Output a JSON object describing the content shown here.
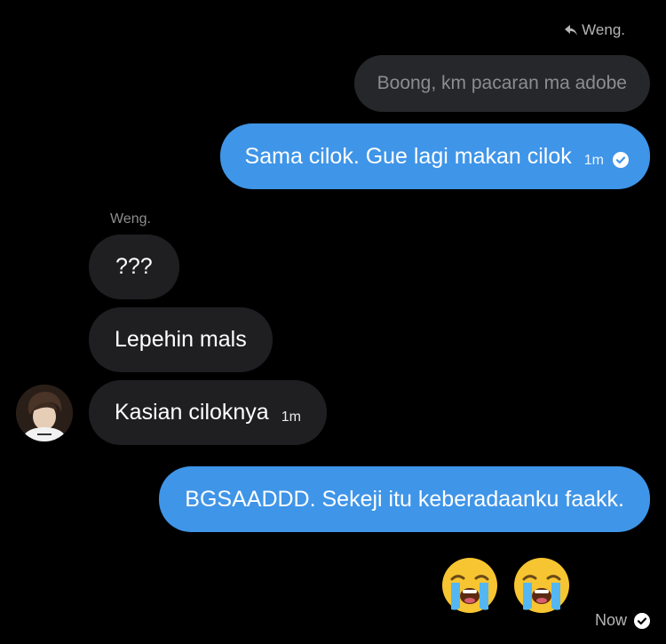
{
  "reply_header": {
    "label": "Weng."
  },
  "messages": {
    "quoted": {
      "text": "Boong, km pacaran ma adobe"
    },
    "out_1": {
      "text": "Sama cilok. Gue lagi makan cilok",
      "time": "1m"
    },
    "sender": "Weng.",
    "in_1": {
      "text": "???"
    },
    "in_2": {
      "text": "Lepehin mals"
    },
    "in_3": {
      "text": "Kasian ciloknya",
      "time": "1m"
    },
    "out_2": {
      "text": "BGSAADDD. Sekeji itu keberadaanku faakk."
    }
  },
  "emojis": [
    "loudly-crying-face",
    "loudly-crying-face"
  ],
  "status": {
    "label": "Now"
  },
  "colors": {
    "background": "#000000",
    "outgoing_bubble": "#3f95e8",
    "incoming_bubble": "#1f1f22",
    "quoted_bubble": "#26272b"
  }
}
